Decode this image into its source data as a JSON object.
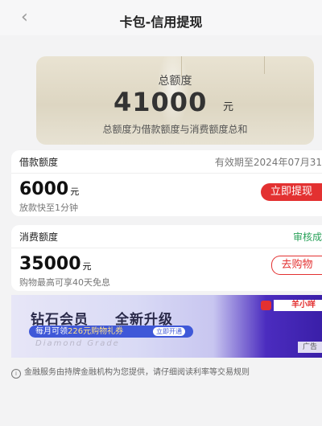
{
  "header": {
    "title": "卡包-信用提现",
    "back_icon": "chevron-left-icon"
  },
  "total": {
    "label": "总额度",
    "amount": "41000",
    "unit": "元",
    "desc": "总额度为借款额度与消费额度总和"
  },
  "loan": {
    "label": "借款额度",
    "validity": "有效期至2024年07月31",
    "amount": "6000",
    "unit": "元",
    "desc": "放款快至1分钟",
    "button": "立即提现"
  },
  "consume": {
    "label": "消费额度",
    "status": "审核成",
    "amount": "35000",
    "unit": "元",
    "desc": "购物最高可享40天免息",
    "button": "去购物"
  },
  "banner": {
    "title1": "钻石会员",
    "title2": "全新升级",
    "promo_pre": "每月可领",
    "promo_hl": "226元购物礼券",
    "open": "立即开通",
    "script": "Diamond Grade",
    "brand": "羊小咩",
    "ad": "广告"
  },
  "footer": {
    "text": "金融服务由持牌金融机构为您提供，请仔细阅读利率等交易规则"
  },
  "colors": {
    "accent": "#e33131",
    "status_green": "#2aa25a"
  }
}
